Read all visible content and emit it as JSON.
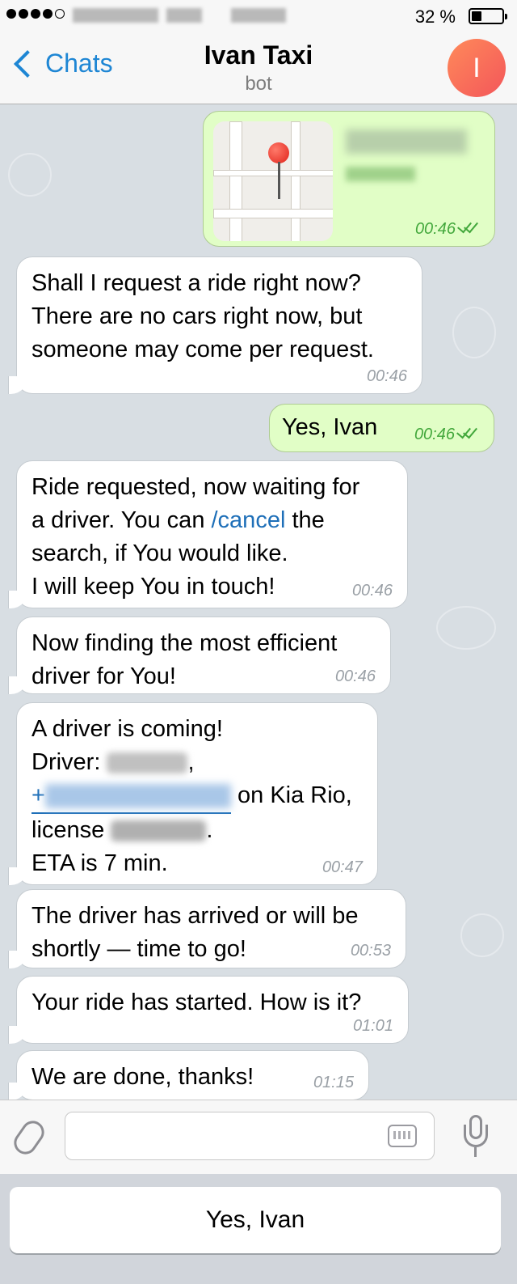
{
  "status_bar": {
    "battery_percent": "32 %",
    "battery_level": 0.32
  },
  "nav": {
    "back_label": "Chats",
    "title": "Ivan Taxi",
    "subtitle": "bot",
    "avatar_initial": "I"
  },
  "messages": [
    {
      "type": "location",
      "direction": "outgoing",
      "time": "00:46",
      "read": true
    },
    {
      "direction": "incoming",
      "lines": [
        "Shall I request a ride right now?",
        "There are no cars right now, but",
        "someone may come per request."
      ],
      "time": "00:46"
    },
    {
      "direction": "outgoing",
      "text": "Yes, Ivan",
      "time": "00:46",
      "read": true
    },
    {
      "direction": "incoming",
      "line1": "Ride requested, now waiting for",
      "line2_pre": "a driver. You can ",
      "command": "/cancel",
      "line2_post": " the",
      "line3": "search, if You would like.",
      "line4": "I will keep You in touch!",
      "time": "00:46"
    },
    {
      "direction": "incoming",
      "lines": [
        "Now finding the most efficient",
        "driver for You!"
      ],
      "time": "00:46"
    },
    {
      "direction": "incoming",
      "line1": "A driver is coming!",
      "driver_label": "Driver:",
      "comma": ",",
      "phone_prefix": "+",
      "car": "on Kia Rio,",
      "license_label": "license",
      "period": ".",
      "eta": "ETA is 7 min.",
      "time": "00:47"
    },
    {
      "direction": "incoming",
      "lines": [
        "The driver has arrived or will be",
        "shortly — time to go!"
      ],
      "time": "00:53"
    },
    {
      "direction": "incoming",
      "lines": [
        "Your ride has started. How is it?"
      ],
      "time": "01:01"
    },
    {
      "direction": "incoming",
      "lines": [
        "We are done, thanks!"
      ],
      "time": "01:15"
    }
  ],
  "input": {
    "value": "",
    "placeholder": ""
  },
  "reply_keyboard": {
    "button": "Yes, Ivan"
  },
  "colors": {
    "accent": "#1e86d4",
    "outgoing_bubble": "#e1fec6",
    "read_ticks": "#43a83c",
    "avatar": "#f3565a"
  }
}
